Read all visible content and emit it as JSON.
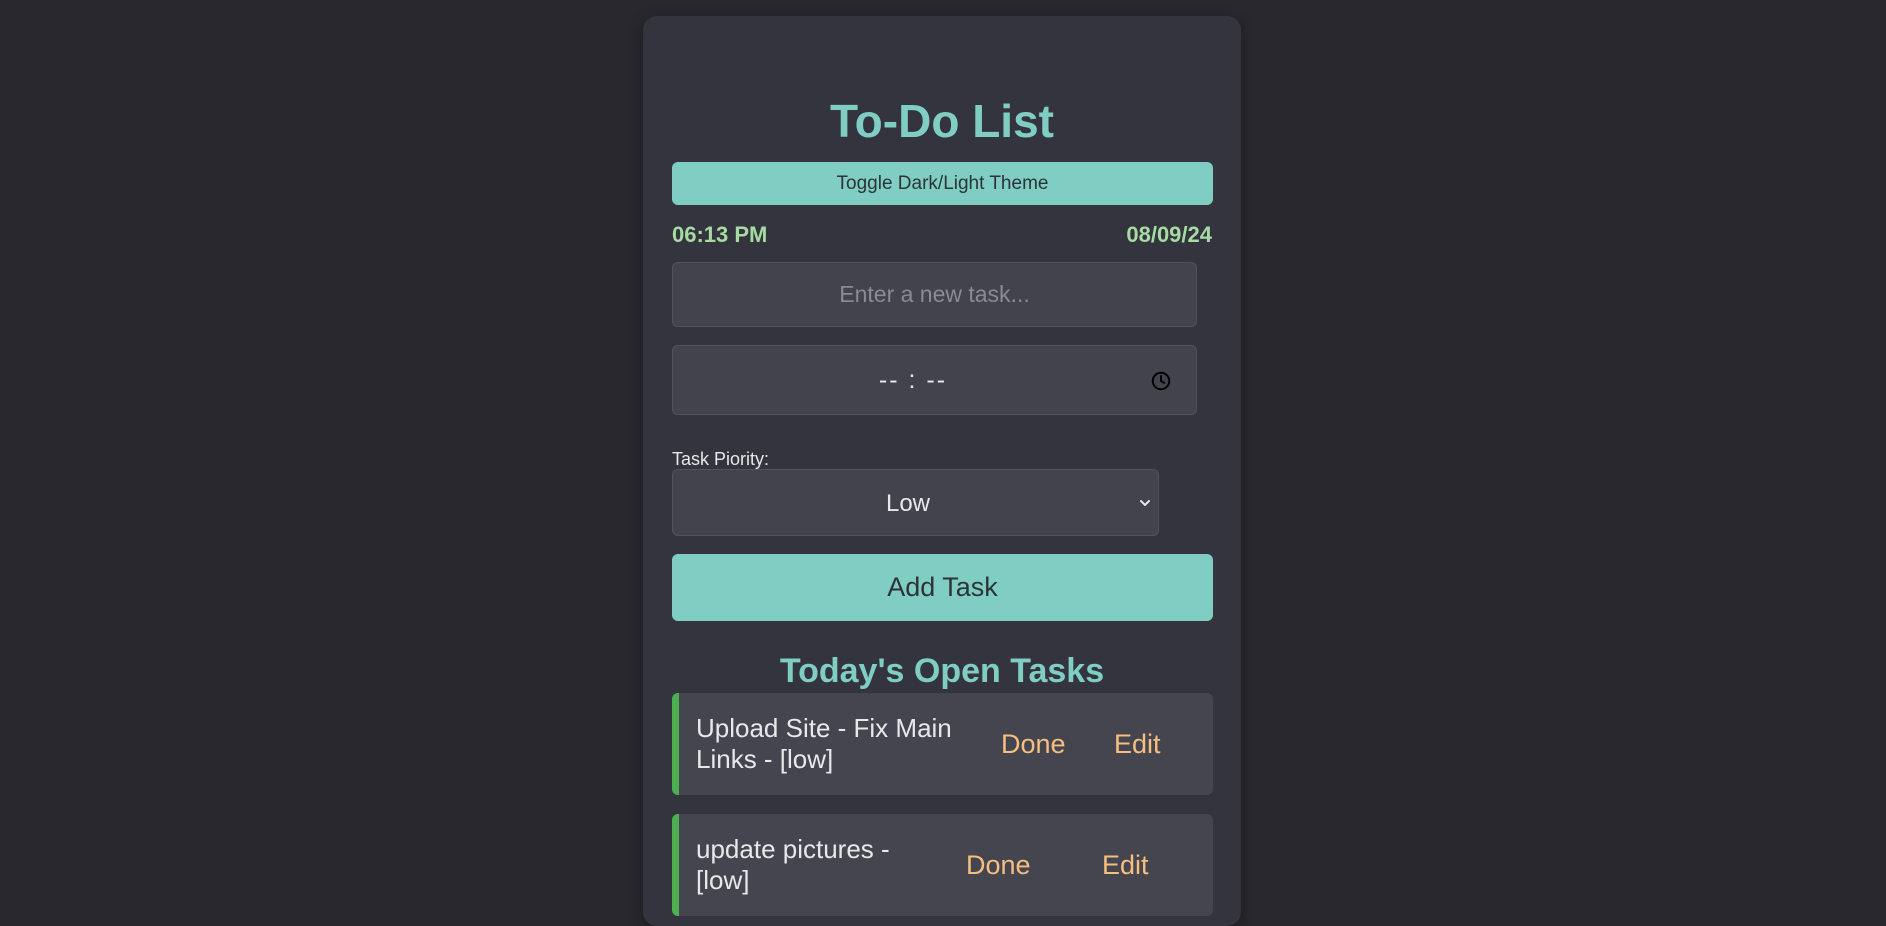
{
  "app": {
    "title": "To-Do List",
    "theme_toggle_label": "Toggle Dark/Light Theme",
    "current_time": "06:13 PM",
    "current_date": "08/09/24"
  },
  "form": {
    "task_placeholder": "Enter a new task...",
    "time_value": "-- : --",
    "priority_label": "Task Piority:",
    "priority_selected": "Low",
    "add_button_label": "Add Task"
  },
  "tasks_section": {
    "title": "Today's Open Tasks",
    "tasks": [
      {
        "text_line1": "Upload Site - Fix Main",
        "text_line2": "Links - [low]",
        "done_label": "Done",
        "edit_label": "Edit",
        "priority_color": "#4caf50"
      },
      {
        "text_line1": "update pictures -",
        "text_line2": "[low]",
        "done_label": "Done",
        "edit_label": "Edit",
        "priority_color": "#4caf50"
      }
    ]
  },
  "colors": {
    "accent": "#7fcdc3",
    "clock_text": "#a6dba2",
    "action_text": "#f6bf7f",
    "background": "#29282e",
    "card": "#34343f"
  }
}
